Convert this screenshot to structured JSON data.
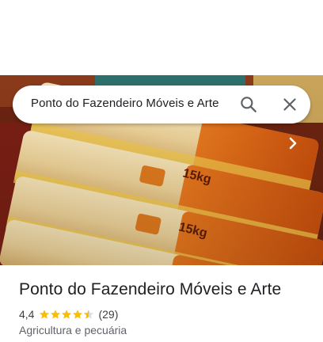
{
  "search": {
    "query": "Ponto do Fazendeiro Móveis e Arte"
  },
  "place": {
    "name": "Ponto do Fazendeiro Móveis e Arte",
    "rating": "4,4",
    "rating_value": 4.4,
    "rating_max": 5,
    "reviews": "(29)",
    "category": "Agricultura e pecuária"
  },
  "photo": {
    "package_labels": [
      "15kg",
      "15kg"
    ]
  },
  "icons": {
    "search": "search-icon",
    "close": "close-icon",
    "next": "chevron-right-icon",
    "star": "star-icon"
  },
  "colors": {
    "star": "#fbbc04",
    "star_empty": "#dadce0",
    "text_primary": "#202124",
    "text_secondary": "#5f6368",
    "icon": "#5f6368"
  }
}
